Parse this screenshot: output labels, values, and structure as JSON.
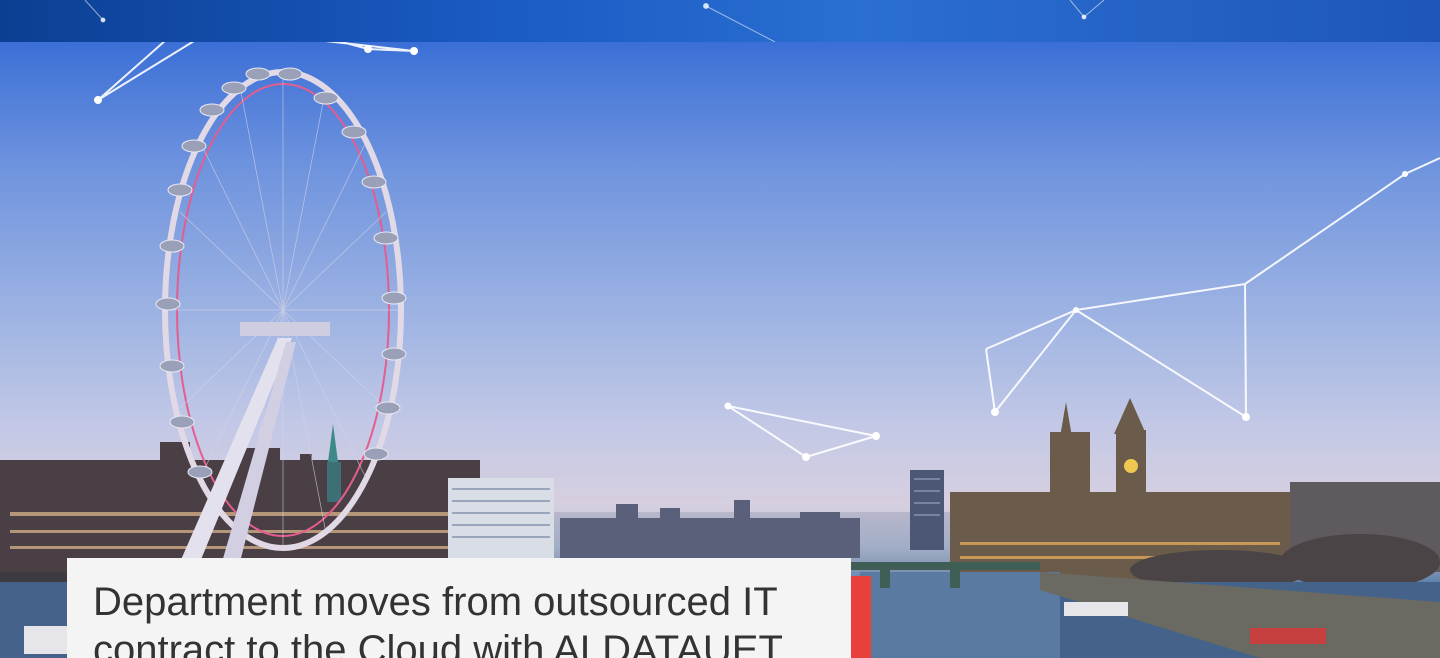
{
  "hero": {
    "headline": "Department moves from outsourced IT contract to the Cloud with ALDATAUET"
  },
  "colors": {
    "accent": "#e8413c",
    "card_background": "#f4f4f4",
    "headline_text": "#333333",
    "top_band": "#1a5bc4"
  },
  "images": {
    "hero_photo": "london-skyline-with-eye-and-big-ben",
    "decoration": "constellation-lines"
  }
}
